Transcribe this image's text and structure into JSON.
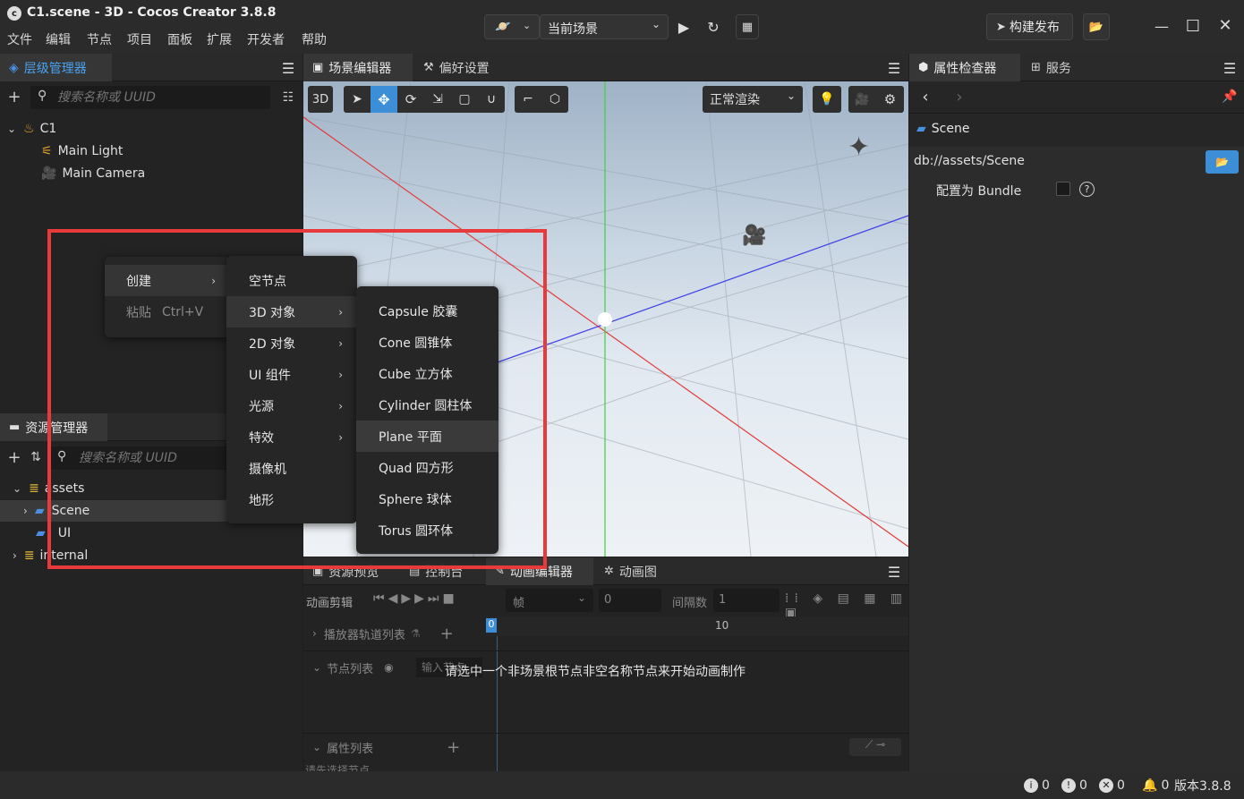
{
  "window": {
    "title": "C1.scene - 3D - Cocos Creator 3.8.8",
    "scene_selector": "当前场景",
    "publish_label": "构建发布"
  },
  "menubar": [
    "文件",
    "编辑",
    "节点",
    "项目",
    "面板",
    "扩展",
    "开发者",
    "帮助"
  ],
  "hierarchy": {
    "tab_label": "层级管理器",
    "search_placeholder": "搜索名称或 UUID",
    "root": "C1",
    "children": [
      "Main Light",
      "Main Camera"
    ]
  },
  "scene_editor": {
    "tabs": [
      "场景编辑器",
      "偏好设置"
    ],
    "mode_3d": "3D",
    "render_mode": "正常渲染"
  },
  "inspector": {
    "tabs": [
      "属性检查器",
      "服务"
    ],
    "asset_name": "Scene",
    "path": "db://assets/Scene",
    "bundle_label": "配置为 Bundle"
  },
  "assets": {
    "tab_label": "资源管理器",
    "search_placeholder": "搜索名称或 UUID",
    "items": [
      "assets",
      "Scene",
      "UI",
      "internal"
    ]
  },
  "context_menu": {
    "main": [
      "创建",
      "粘贴"
    ],
    "paste_shortcut": "Ctrl+V",
    "create": [
      "空节点",
      "3D 对象",
      "2D 对象",
      "UI 组件",
      "光源",
      "特效",
      "摄像机",
      "地形"
    ],
    "objects_3d": [
      "Capsule 胶囊",
      "Cone 圆锥体",
      "Cube 立方体",
      "Cylinder 圆柱体",
      "Plane 平面",
      "Quad 四方形",
      "Sphere 球体",
      "Torus 圆环体"
    ]
  },
  "bottom_panel": {
    "tabs": [
      "资源预览",
      "控制台",
      "动画编辑器",
      "动画图"
    ],
    "clip_label": "动画剪辑",
    "frame_label": "帧",
    "frame_value": "0",
    "interval_label": "间隔数",
    "interval_value": "1",
    "track_list": "播放器轨道列表",
    "node_list": "节点列表",
    "node_input_placeholder": "输入节点",
    "message": "请选中一个非场景根节点非空名称节点来开始动画制作",
    "property_list": "属性列表",
    "timeline_start": "0",
    "timeline_mark": "10",
    "bottom_hint": "请先选择节点"
  },
  "statusbar": {
    "info": "0",
    "warn": "0",
    "error": "0",
    "notify": "0",
    "version": "版本3.8.8"
  },
  "colors": {
    "highlight_red": "#e8393b",
    "accent_blue": "#3c8ed7",
    "folder_blue": "#4a90e2",
    "assets_yellow": "#e2b83a"
  }
}
